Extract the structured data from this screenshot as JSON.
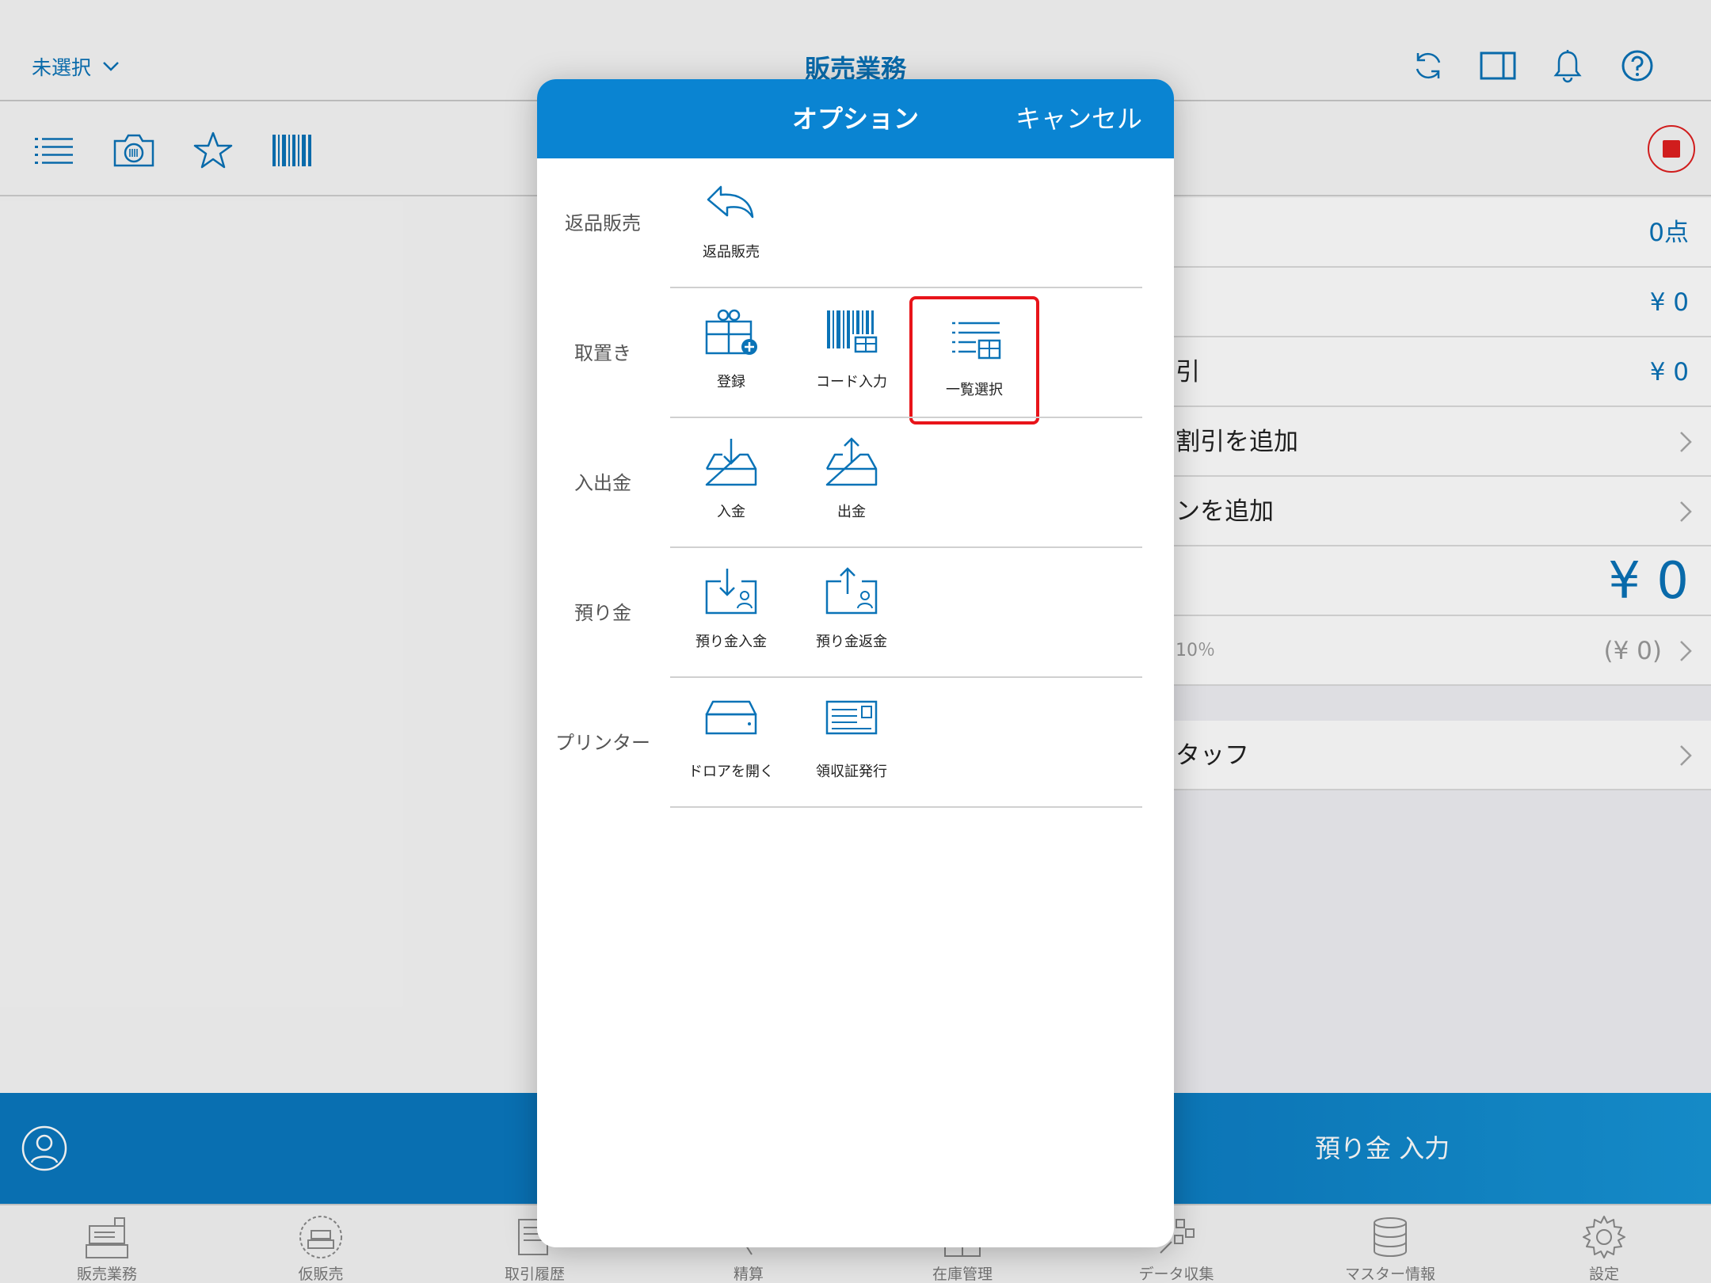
{
  "header": {
    "store_select": "未選択",
    "title": "販売業務"
  },
  "summary": {
    "count": "0点",
    "subtotal": "¥ 0",
    "discount_label": "引",
    "discount_value": "¥ 0",
    "add_discount": "割引を追加",
    "add_coupon": "ンを追加",
    "total": "¥ 0",
    "tax_rate": "10％",
    "tax_value": "(¥ 0)",
    "staff": "タッフ"
  },
  "bottom": {
    "deposit_input": "預り金 入力"
  },
  "tabs": [
    {
      "label": "販売業務"
    },
    {
      "label": "仮販売"
    },
    {
      "label": "取引履歴"
    },
    {
      "label": "精算"
    },
    {
      "label": "在庫管理"
    },
    {
      "label": "データ収集"
    },
    {
      "label": "マスター情報"
    },
    {
      "label": "設定"
    }
  ],
  "modal": {
    "title": "オプション",
    "cancel": "キャンセル",
    "sections": [
      {
        "label": "返品販売",
        "options": [
          {
            "label": "返品販売",
            "icon": "return-arrow-icon"
          }
        ]
      },
      {
        "label": "取置き",
        "options": [
          {
            "label": "登録",
            "icon": "gift-add-icon"
          },
          {
            "label": "コード入力",
            "icon": "barcode-gift-icon"
          },
          {
            "label": "一覧選択",
            "icon": "list-gift-icon"
          }
        ]
      },
      {
        "label": "入出金",
        "options": [
          {
            "label": "入金",
            "icon": "tray-in-icon"
          },
          {
            "label": "出金",
            "icon": "tray-out-icon"
          }
        ]
      },
      {
        "label": "預り金",
        "options": [
          {
            "label": "預り金入金",
            "icon": "deposit-in-icon"
          },
          {
            "label": "預り金返金",
            "icon": "deposit-refund-icon"
          }
        ]
      },
      {
        "label": "プリンター",
        "options": [
          {
            "label": "ドロアを開く",
            "icon": "drawer-icon"
          },
          {
            "label": "領収証発行",
            "icon": "receipt-icon"
          }
        ]
      }
    ],
    "highlighted_option": "一覧選択"
  },
  "colors": {
    "accent": "#0a84d2",
    "text_blue": "#0a73b7",
    "highlight": "#e8141a"
  }
}
